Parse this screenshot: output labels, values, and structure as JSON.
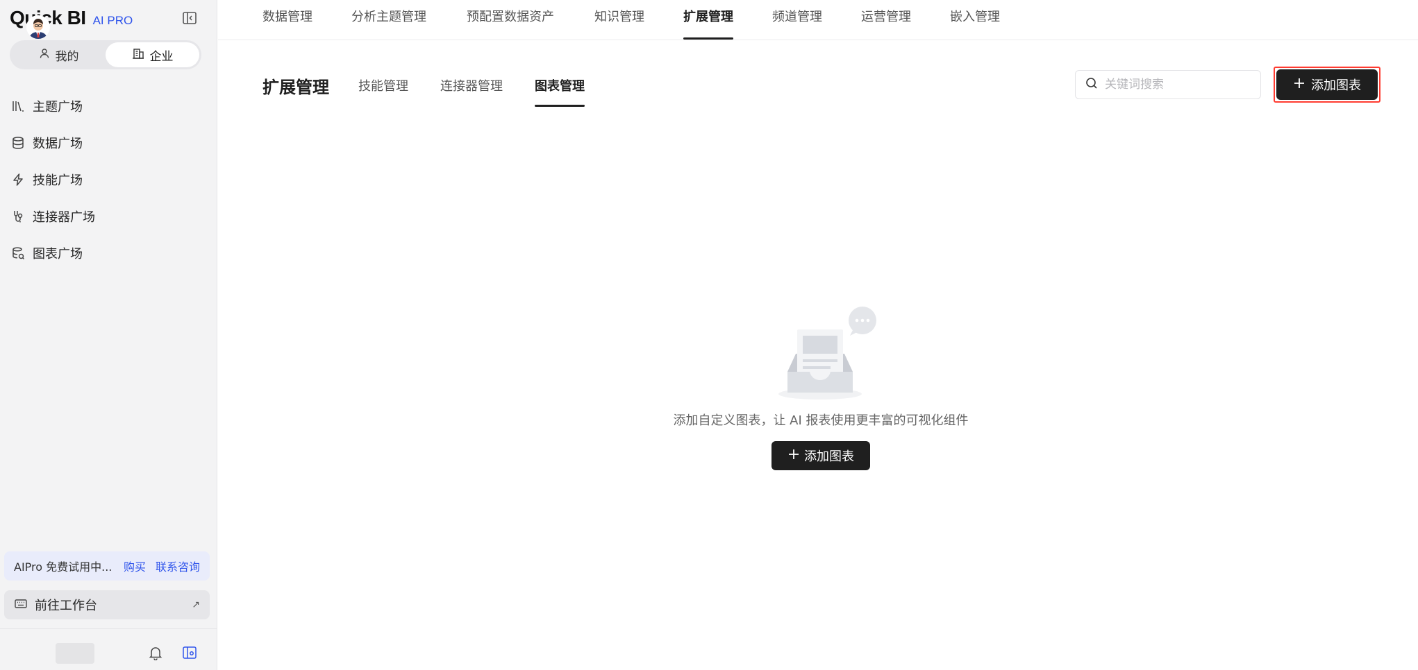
{
  "brand": {
    "name": "Quick BI",
    "tag": "AI PRO"
  },
  "scope": {
    "mine": "我的",
    "enterprise": "企业",
    "selected": "企业"
  },
  "sidebar": {
    "items": [
      {
        "label": "主题广场",
        "icon": "books-icon"
      },
      {
        "label": "数据广场",
        "icon": "database-icon"
      },
      {
        "label": "技能广场",
        "icon": "lightning-icon"
      },
      {
        "label": "连接器广场",
        "icon": "connector-icon"
      },
      {
        "label": "图表广场",
        "icon": "chart-database-icon"
      }
    ],
    "trial": {
      "text": "AIPro 免费试用中...",
      "buy": "购买",
      "contact": "联系咨询"
    },
    "workbench": {
      "label": "前往工作台",
      "arrow": "↗"
    }
  },
  "topnav": {
    "items": [
      "数据管理",
      "分析主题管理",
      "预配置数据资产",
      "知识管理",
      "扩展管理",
      "频道管理",
      "运营管理",
      "嵌入管理"
    ],
    "active": "扩展管理"
  },
  "page": {
    "title": "扩展管理",
    "subtabs": [
      "技能管理",
      "连接器管理",
      "图表管理"
    ],
    "active_subtab": "图表管理"
  },
  "search": {
    "placeholder": "关键词搜索",
    "value": ""
  },
  "add_button": {
    "label": "添加图表"
  },
  "empty": {
    "text": "添加自定义图表，让 AI 报表使用更丰富的可视化组件",
    "button": "添加图表"
  },
  "colors": {
    "accent": "#2f54eb",
    "primary_button": "#1f1f1f",
    "highlight_border": "#ff3b30",
    "sidebar_bg": "#f3f3f4"
  }
}
